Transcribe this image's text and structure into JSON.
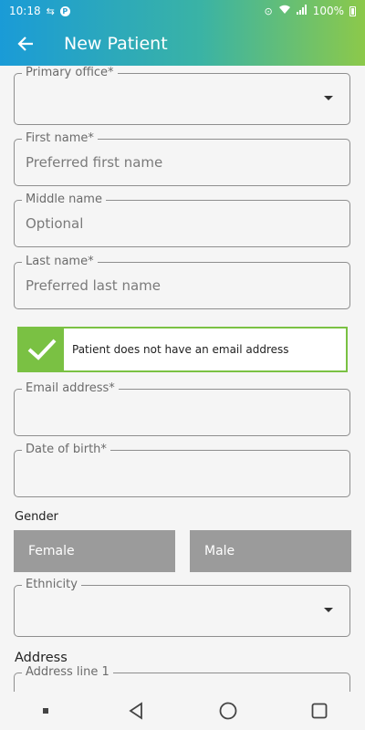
{
  "status_bar": {
    "time": "10:18",
    "battery": "100%"
  },
  "app_bar": {
    "title": "New Patient"
  },
  "form": {
    "primary_office": {
      "label": "Primary office*",
      "value": ""
    },
    "first_name": {
      "label": "First name*",
      "placeholder": "Preferred first name"
    },
    "middle_name": {
      "label": "Middle name",
      "placeholder": "Optional"
    },
    "last_name": {
      "label": "Last name*",
      "placeholder": "Preferred last name"
    },
    "no_email_checkbox": {
      "label": "Patient does not have an email address",
      "checked": true
    },
    "email": {
      "label": "Email address*",
      "value": ""
    },
    "date_of_birth": {
      "label": "Date of birth*",
      "value": ""
    },
    "gender": {
      "label": "Gender",
      "options": [
        "Female",
        "Male"
      ]
    },
    "ethnicity": {
      "label": "Ethnicity",
      "value": ""
    },
    "address": {
      "heading": "Address",
      "line1_label": "Address line 1"
    }
  },
  "colors": {
    "gradient_start": "#1a9bd7",
    "gradient_end": "#8cc94a",
    "check_green": "#7ac143",
    "gender_button": "#9b9b9b"
  }
}
